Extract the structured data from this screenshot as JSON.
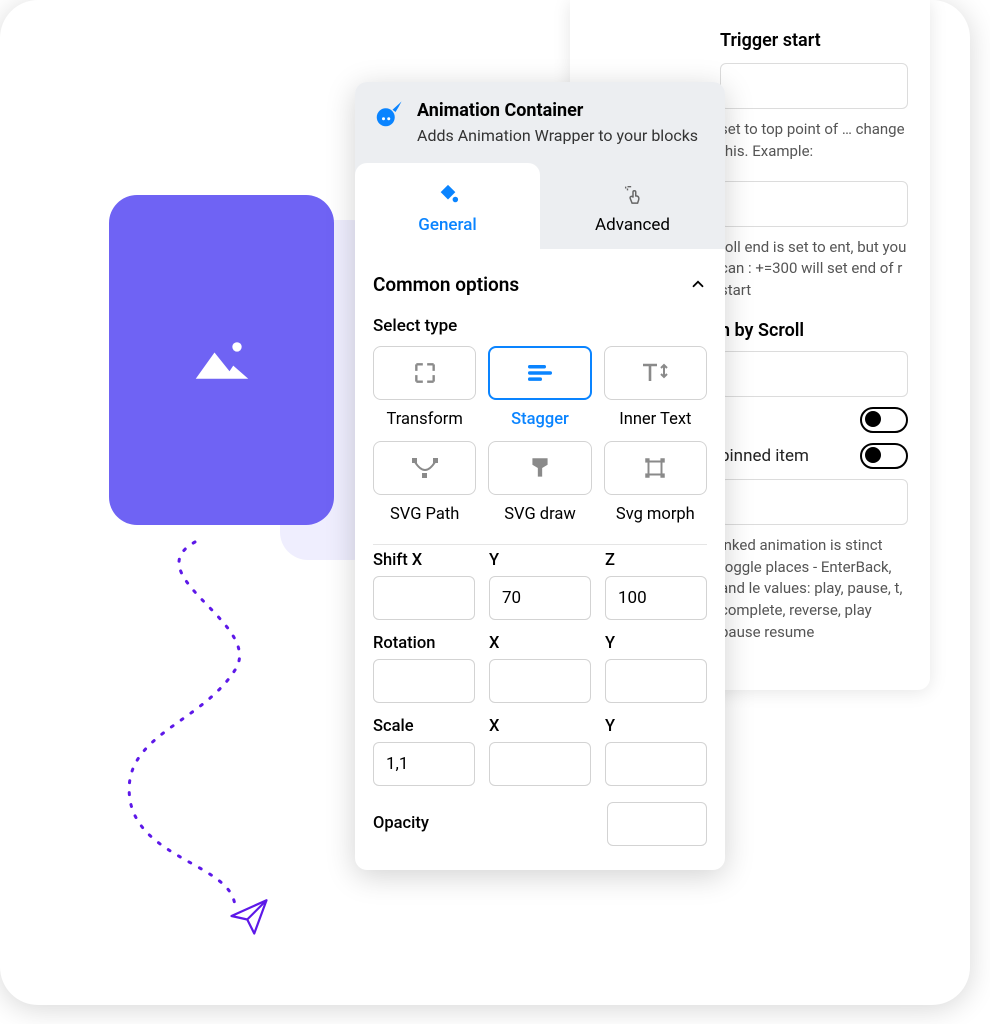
{
  "header": {
    "title": "Animation Container",
    "subtitle": "Adds Animation Wrapper to your blocks"
  },
  "tabs": {
    "general": "General",
    "advanced": "Advanced",
    "active": "general"
  },
  "common_options": {
    "title": "Common options",
    "select_type_label": "Select type",
    "types": [
      {
        "id": "transform",
        "label": "Transform"
      },
      {
        "id": "stagger",
        "label": "Stagger",
        "selected": true
      },
      {
        "id": "innertext",
        "label": "Inner Text"
      },
      {
        "id": "svgpath",
        "label": "SVG Path"
      },
      {
        "id": "svgdraw",
        "label": "SVG draw"
      },
      {
        "id": "svgmorph",
        "label": "Svg morph"
      }
    ],
    "shift": {
      "x_label": "Shift X",
      "y_label": "Y",
      "z_label": "Z",
      "x": "",
      "y": "70",
      "z": "100"
    },
    "rotation": {
      "label": "Rotation",
      "x_label": "X",
      "y_label": "Y",
      "r": "",
      "x": "",
      "y": ""
    },
    "scale": {
      "label": "Scale",
      "x_label": "X",
      "y_label": "Y",
      "s": "1,1",
      "x": "",
      "y": ""
    },
    "opacity": {
      "label": "Opacity",
      "value": ""
    }
  },
  "back_panel": {
    "trigger_start_title": "Trigger start",
    "trigger_start_desc": "set to top point of … change this. Example:",
    "trigger_end_desc": "roll end is set to ent, but you can : +=300 will set end of r start",
    "section2_title": "n by Scroll",
    "pinned_item_label": "pinned item",
    "actions_desc": "inked animation is stinct toggle places - EnterBack, and le values: play, pause, t, complete, reverse, play pause resume"
  },
  "colors": {
    "accent": "#0a84ff",
    "purple": "#6f63f4",
    "dash": "#5d18e8"
  }
}
